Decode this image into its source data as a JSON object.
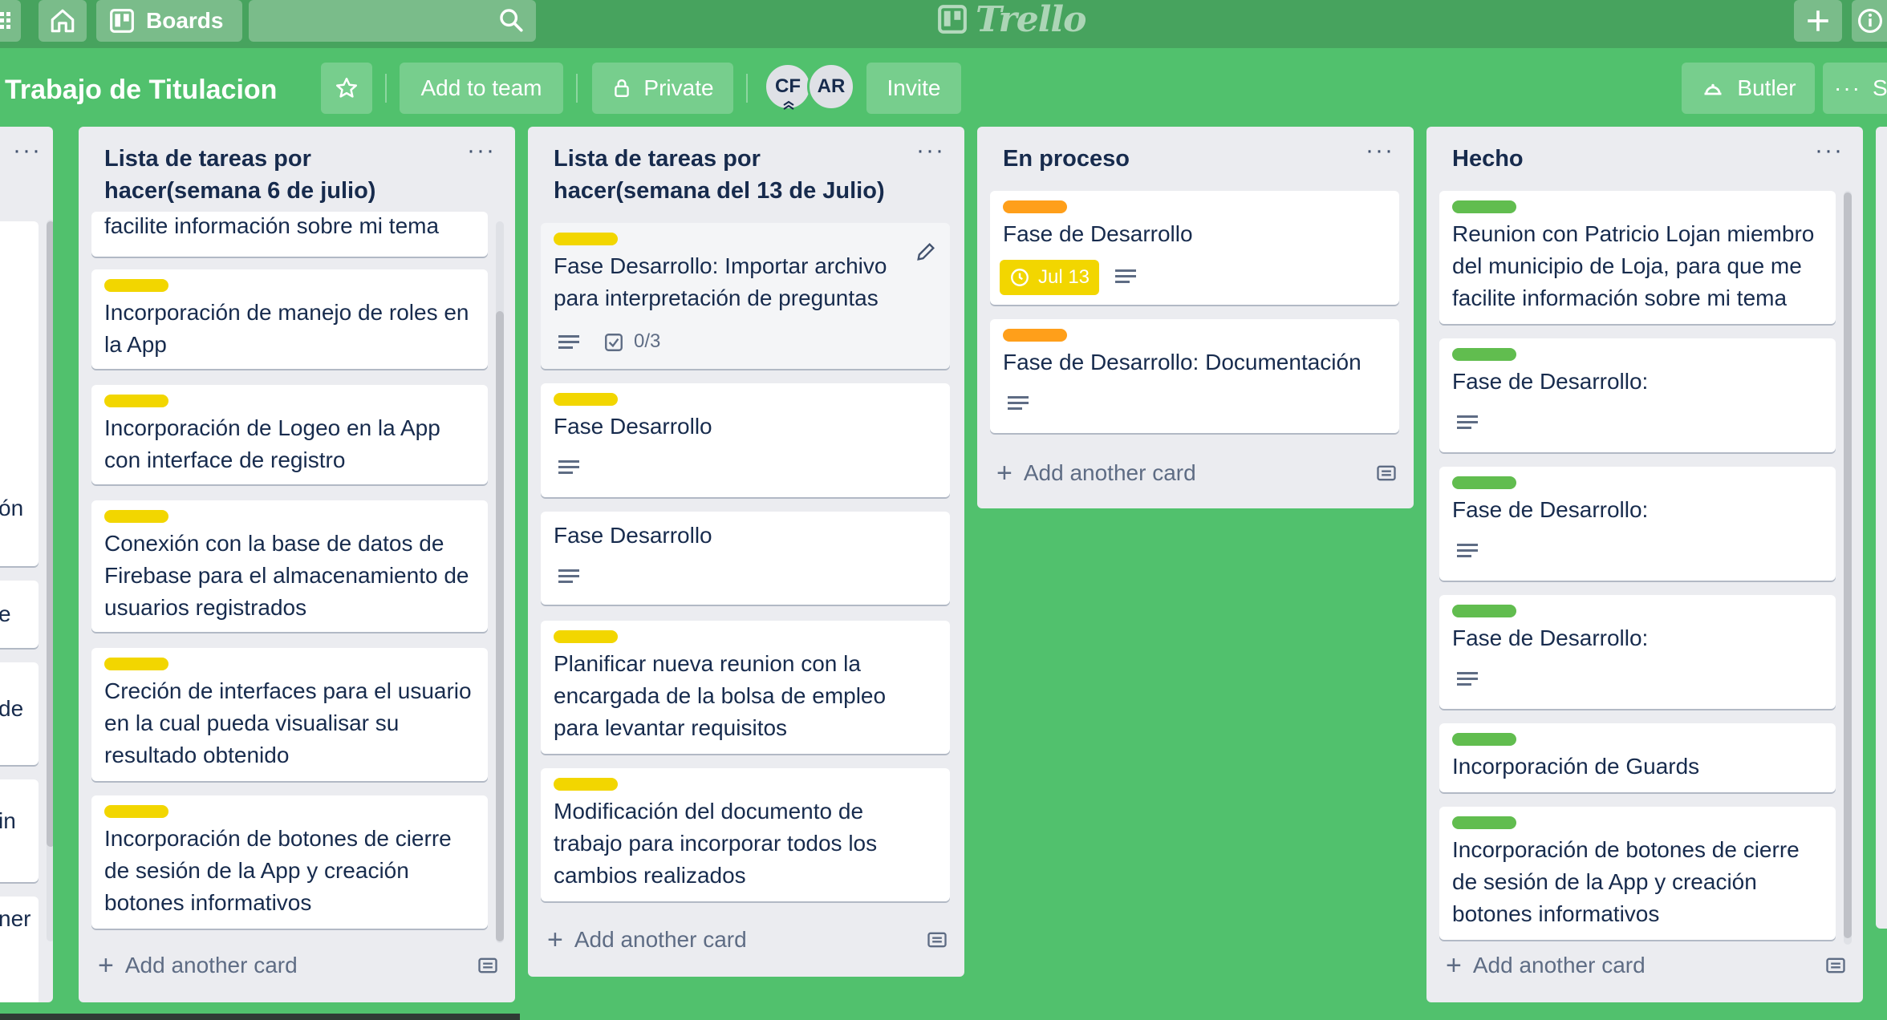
{
  "header": {
    "boards_label": "Boards",
    "logo_text": "Trello"
  },
  "board": {
    "title": "Trabajo de Titulacion",
    "add_to_team": "Add to team",
    "visibility": "Private",
    "members": [
      "CF",
      "AR"
    ],
    "invite": "Invite",
    "butler": "Butler",
    "more_partial": "S"
  },
  "colors": {
    "background": "#51c16d",
    "label_yellow": "#f2d600",
    "label_orange": "#ff9f1a",
    "label_green": "#61bd4f"
  },
  "partial_list": {
    "text_fragments": [
      "ón",
      "e",
      "de",
      "in",
      "ner"
    ]
  },
  "lists": [
    {
      "title": "Lista de tareas por hacer(semana 6 de julio)",
      "cards": [
        {
          "title": "facilite información sobre mi tema"
        },
        {
          "title": "Incorporación de manejo de roles en la App"
        },
        {
          "title": "Incorporación de Logeo en la App con interface de registro"
        },
        {
          "title": "Conexión con la base de datos de Firebase para el almacenamiento de usuarios registrados"
        },
        {
          "title": "Creción de interfaces para el usuario en la cual pueda visualisar su resultado obtenido"
        },
        {
          "title": "Incorporación de botones de cierre de sesión de la App y creación botones informativos"
        }
      ],
      "add_card": "Add another card"
    },
    {
      "title": "Lista de tareas por hacer(semana del 13 de Julio)",
      "cards": [
        {
          "title": "Fase Desarrollo: Importar archivo para interpretación de preguntas",
          "checklist": "0/3"
        },
        {
          "title": "Fase Desarrollo"
        },
        {
          "title": "Fase Desarrollo"
        },
        {
          "title": "Planificar nueva reunion con la encargada de la bolsa de empleo para levantar requisitos"
        },
        {
          "title": "Modificación del documento de trabajo para incorporar todos los cambios realizados"
        }
      ],
      "add_card": "Add another card"
    },
    {
      "title": "En proceso",
      "cards": [
        {
          "title": "Fase de Desarrollo",
          "due": "Jul 13"
        },
        {
          "title": "Fase de Desarrollo: Documentación"
        }
      ],
      "add_card": "Add another card"
    },
    {
      "title": "Hecho",
      "cards": [
        {
          "title": "Reunion con Patricio Lojan miembro del municipio de Loja, para que me facilite información sobre mi tema"
        },
        {
          "title": "Fase de Desarrollo:"
        },
        {
          "title": "Fase de Desarrollo:"
        },
        {
          "title": "Fase de Desarrollo:"
        },
        {
          "title": "Incorporación de Guards"
        },
        {
          "title": "Incorporación de botones de cierre de sesión de la App y creación botones informativos"
        }
      ],
      "add_card": "Add another card"
    }
  ]
}
